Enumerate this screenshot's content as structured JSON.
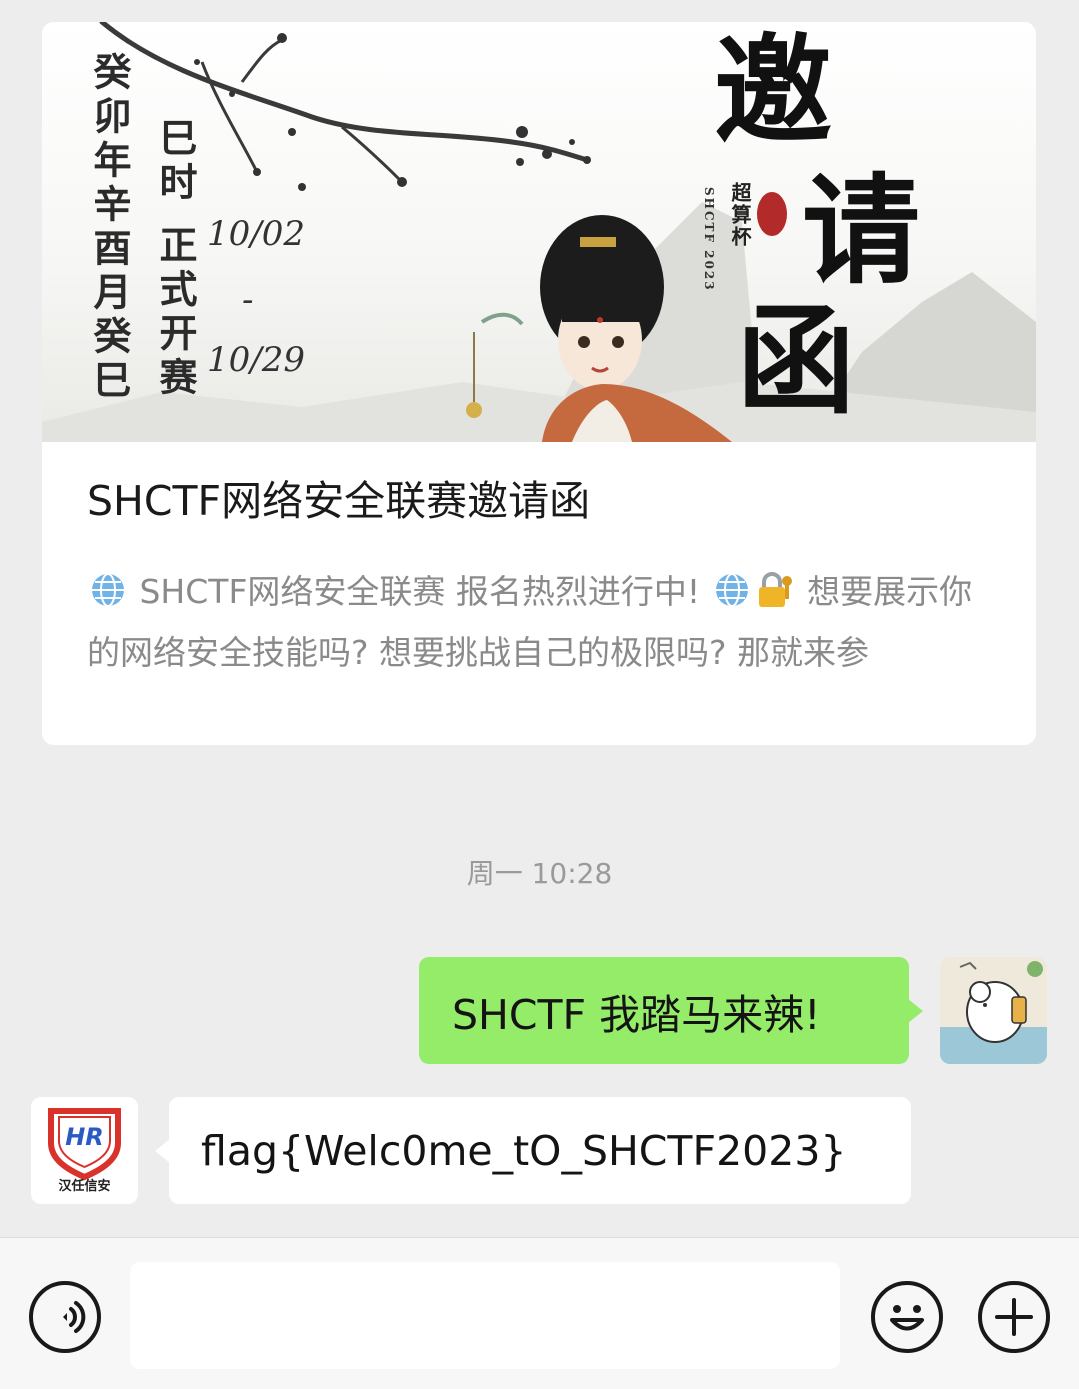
{
  "article": {
    "banner": {
      "vertical_date": "癸卯年辛酉月癸巳",
      "vertical_open": "巳时 正式开赛",
      "date_start": "10/02",
      "date_dash": "-",
      "date_end": "10/29",
      "title_chars": [
        "邀",
        "请",
        "函"
      ],
      "subtitle_vertical": "SHCTF 2023",
      "cup_name": "超算杯"
    },
    "title": "SHCTF网络安全联赛邀请函",
    "desc_part1": " SHCTF网络安全联赛 报名热烈进行中! ",
    "desc_part2": " 想要展示你的网络安全技能吗? 想要挑战自己的极限吗? 那就来参"
  },
  "timestamp": "周一 10:28",
  "messages": [
    {
      "from": "me",
      "text": "SHCTF 我踏马来辣!"
    },
    {
      "from": "them",
      "sender_label": "汉任信安",
      "avatar_mark": "HR",
      "text": "flag{Welc0me_tO_SHCTF2023}"
    }
  ],
  "input_bar": {
    "voice_icon": "voice-icon",
    "emoji_icon": "emoji-icon",
    "plus_icon": "plus-icon",
    "input_value": ""
  },
  "colors": {
    "background": "#ededed",
    "sent_bubble": "#95ec69",
    "received_bubble": "#ffffff",
    "hr_red": "#d9322b",
    "hr_blue": "#2a5bc4"
  }
}
